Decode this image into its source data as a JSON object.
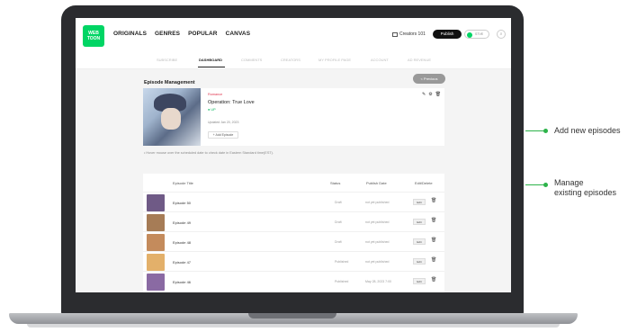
{
  "nav": {
    "logo_text": "WEB TOON",
    "items": [
      "ORIGINALS",
      "GENRES",
      "POPULAR",
      "CANVAS"
    ],
    "creators_label": "Creators 101",
    "publish_label": "Publish",
    "user_label": "STVE"
  },
  "subnav": {
    "items": [
      "SUBSCRIBE",
      "DASHBOARD",
      "COMMENTS",
      "CREATORS",
      "MY PROFILE PAGE",
      "ACCOUNT",
      "AD REVENUE"
    ],
    "active": "DASHBOARD"
  },
  "page": {
    "title": "Episode Management",
    "previous_label": "< Previous"
  },
  "series": {
    "genre": "Romance",
    "title": "Operation: True Love",
    "badge": "UP",
    "updated": "Updated Jan 20, 2023",
    "add_episode_label": "+ Add Episode"
  },
  "notice": "• Hover mouse over the scheduled date to check date in Eastern Standard time(EST).",
  "table": {
    "headers": [
      "Episode Title",
      "Status",
      "Publish Date",
      "Edit/Delete"
    ],
    "rows": [
      {
        "title": "Episode 50",
        "status": "Draft",
        "date": "not yet published",
        "edit": "Edit",
        "thumb_color": "#6f5a86"
      },
      {
        "title": "Episode 49",
        "status": "Draft",
        "date": "not yet published",
        "edit": "Edit",
        "thumb_color": "#a67c56"
      },
      {
        "title": "Episode 48",
        "status": "Draft",
        "date": "not yet published",
        "edit": "Edit",
        "thumb_color": "#c48b5c"
      },
      {
        "title": "Episode 47",
        "status": "Published",
        "date": "not yet published",
        "edit": "Edit",
        "thumb_color": "#e3b06a"
      },
      {
        "title": "Episode 46",
        "status": "Published",
        "date": "May 28, 2023 7:00",
        "edit": "Edit",
        "thumb_color": "#8a6aa3"
      }
    ]
  },
  "annotations": {
    "add_new": "Add new episodes",
    "manage_line1": "Manage",
    "manage_line2": "existing episodes"
  },
  "colors": {
    "accent_green": "#00d564",
    "callout_green": "#2db34a",
    "genre_red": "#e0334c"
  }
}
